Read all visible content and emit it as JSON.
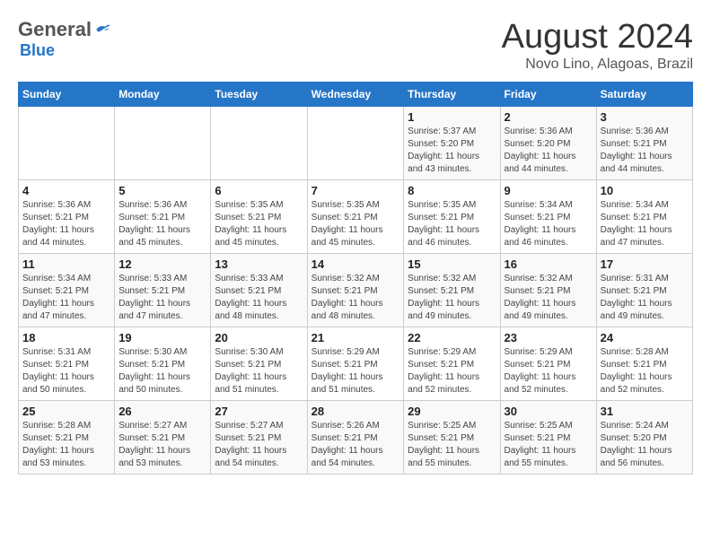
{
  "header": {
    "logo_general": "General",
    "logo_blue": "Blue",
    "title": "August 2024",
    "subtitle": "Novo Lino, Alagoas, Brazil"
  },
  "calendar": {
    "days_of_week": [
      "Sunday",
      "Monday",
      "Tuesday",
      "Wednesday",
      "Thursday",
      "Friday",
      "Saturday"
    ],
    "weeks": [
      [
        {
          "day": "",
          "info": ""
        },
        {
          "day": "",
          "info": ""
        },
        {
          "day": "",
          "info": ""
        },
        {
          "day": "",
          "info": ""
        },
        {
          "day": "1",
          "info": "Sunrise: 5:37 AM\nSunset: 5:20 PM\nDaylight: 11 hours and 43 minutes."
        },
        {
          "day": "2",
          "info": "Sunrise: 5:36 AM\nSunset: 5:20 PM\nDaylight: 11 hours and 44 minutes."
        },
        {
          "day": "3",
          "info": "Sunrise: 5:36 AM\nSunset: 5:21 PM\nDaylight: 11 hours and 44 minutes."
        }
      ],
      [
        {
          "day": "4",
          "info": "Sunrise: 5:36 AM\nSunset: 5:21 PM\nDaylight: 11 hours and 44 minutes."
        },
        {
          "day": "5",
          "info": "Sunrise: 5:36 AM\nSunset: 5:21 PM\nDaylight: 11 hours and 45 minutes."
        },
        {
          "day": "6",
          "info": "Sunrise: 5:35 AM\nSunset: 5:21 PM\nDaylight: 11 hours and 45 minutes."
        },
        {
          "day": "7",
          "info": "Sunrise: 5:35 AM\nSunset: 5:21 PM\nDaylight: 11 hours and 45 minutes."
        },
        {
          "day": "8",
          "info": "Sunrise: 5:35 AM\nSunset: 5:21 PM\nDaylight: 11 hours and 46 minutes."
        },
        {
          "day": "9",
          "info": "Sunrise: 5:34 AM\nSunset: 5:21 PM\nDaylight: 11 hours and 46 minutes."
        },
        {
          "day": "10",
          "info": "Sunrise: 5:34 AM\nSunset: 5:21 PM\nDaylight: 11 hours and 47 minutes."
        }
      ],
      [
        {
          "day": "11",
          "info": "Sunrise: 5:34 AM\nSunset: 5:21 PM\nDaylight: 11 hours and 47 minutes."
        },
        {
          "day": "12",
          "info": "Sunrise: 5:33 AM\nSunset: 5:21 PM\nDaylight: 11 hours and 47 minutes."
        },
        {
          "day": "13",
          "info": "Sunrise: 5:33 AM\nSunset: 5:21 PM\nDaylight: 11 hours and 48 minutes."
        },
        {
          "day": "14",
          "info": "Sunrise: 5:32 AM\nSunset: 5:21 PM\nDaylight: 11 hours and 48 minutes."
        },
        {
          "day": "15",
          "info": "Sunrise: 5:32 AM\nSunset: 5:21 PM\nDaylight: 11 hours and 49 minutes."
        },
        {
          "day": "16",
          "info": "Sunrise: 5:32 AM\nSunset: 5:21 PM\nDaylight: 11 hours and 49 minutes."
        },
        {
          "day": "17",
          "info": "Sunrise: 5:31 AM\nSunset: 5:21 PM\nDaylight: 11 hours and 49 minutes."
        }
      ],
      [
        {
          "day": "18",
          "info": "Sunrise: 5:31 AM\nSunset: 5:21 PM\nDaylight: 11 hours and 50 minutes."
        },
        {
          "day": "19",
          "info": "Sunrise: 5:30 AM\nSunset: 5:21 PM\nDaylight: 11 hours and 50 minutes."
        },
        {
          "day": "20",
          "info": "Sunrise: 5:30 AM\nSunset: 5:21 PM\nDaylight: 11 hours and 51 minutes."
        },
        {
          "day": "21",
          "info": "Sunrise: 5:29 AM\nSunset: 5:21 PM\nDaylight: 11 hours and 51 minutes."
        },
        {
          "day": "22",
          "info": "Sunrise: 5:29 AM\nSunset: 5:21 PM\nDaylight: 11 hours and 52 minutes."
        },
        {
          "day": "23",
          "info": "Sunrise: 5:29 AM\nSunset: 5:21 PM\nDaylight: 11 hours and 52 minutes."
        },
        {
          "day": "24",
          "info": "Sunrise: 5:28 AM\nSunset: 5:21 PM\nDaylight: 11 hours and 52 minutes."
        }
      ],
      [
        {
          "day": "25",
          "info": "Sunrise: 5:28 AM\nSunset: 5:21 PM\nDaylight: 11 hours and 53 minutes."
        },
        {
          "day": "26",
          "info": "Sunrise: 5:27 AM\nSunset: 5:21 PM\nDaylight: 11 hours and 53 minutes."
        },
        {
          "day": "27",
          "info": "Sunrise: 5:27 AM\nSunset: 5:21 PM\nDaylight: 11 hours and 54 minutes."
        },
        {
          "day": "28",
          "info": "Sunrise: 5:26 AM\nSunset: 5:21 PM\nDaylight: 11 hours and 54 minutes."
        },
        {
          "day": "29",
          "info": "Sunrise: 5:25 AM\nSunset: 5:21 PM\nDaylight: 11 hours and 55 minutes."
        },
        {
          "day": "30",
          "info": "Sunrise: 5:25 AM\nSunset: 5:21 PM\nDaylight: 11 hours and 55 minutes."
        },
        {
          "day": "31",
          "info": "Sunrise: 5:24 AM\nSunset: 5:20 PM\nDaylight: 11 hours and 56 minutes."
        }
      ]
    ]
  }
}
